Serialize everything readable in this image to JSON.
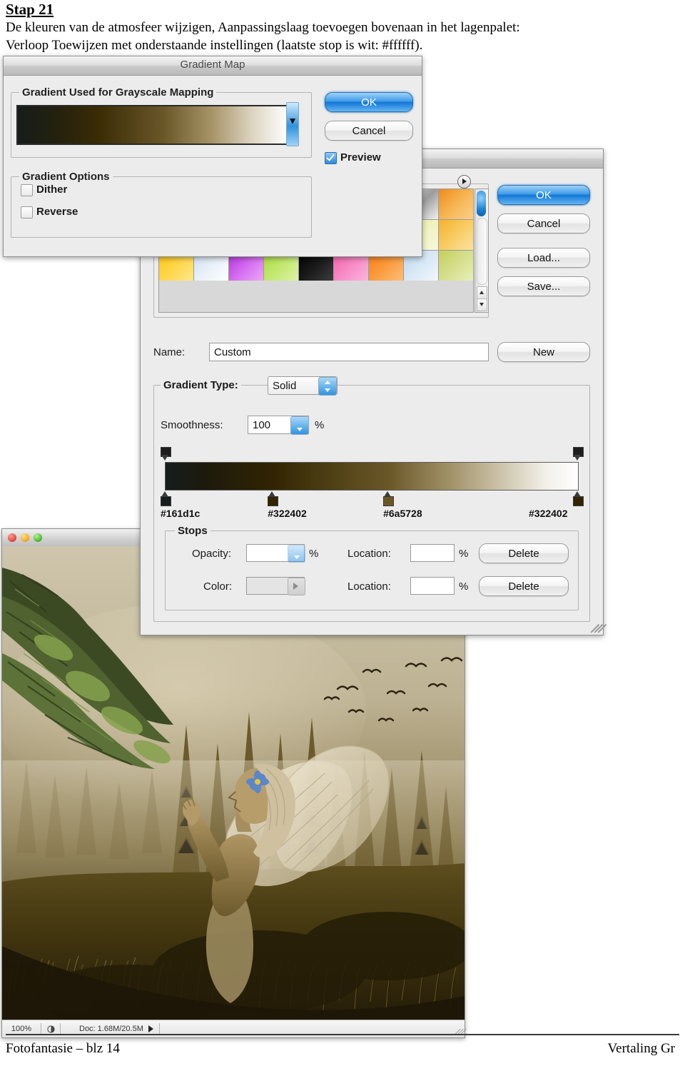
{
  "document": {
    "step_title": "Stap 21",
    "line1": "De kleuren van de atmosfeer wijzigen, Aanpassingslaag toevoegen bovenaan in het lagenpalet:",
    "line2": "Verloop Toewijzen met onderstaande instellingen (laatste stop is wit: #ffffff).",
    "footer_left": "Fotofantasie – blz 14",
    "footer_right": "Vertaling Gr"
  },
  "gradient_map_dialog": {
    "title": "Gradient Map",
    "group_gradient_label": "Gradient Used for Grayscale Mapping",
    "group_options_label": "Gradient Options",
    "dither_label": "Dither",
    "reverse_label": "Reverse",
    "preview_label": "Preview",
    "preview_checked": true,
    "dither_checked": false,
    "reverse_checked": false,
    "ok_label": "OK",
    "cancel_label": "Cancel"
  },
  "gradient_editor_dialog": {
    "ok_label": "OK",
    "cancel_label": "Cancel",
    "load_label": "Load...",
    "save_label": "Save...",
    "new_label": "New",
    "name_label": "Name:",
    "name_value": "Custom",
    "gradient_type_label": "Gradient Type:",
    "gradient_type_value": "Solid",
    "smoothness_label": "Smoothness:",
    "smoothness_value": "100",
    "percent_symbol": "%",
    "stops_group_label": "Stops",
    "opacity_label": "Opacity:",
    "opacity_value": "",
    "color_label": "Color:",
    "location_label": "Location:",
    "opacity_location_value": "",
    "color_location_value": "",
    "delete_label": "Delete",
    "presets": [
      [
        "#3b2e73",
        "#c86a16",
        "#f2a13a",
        "#1a3a74",
        "#0d2a57"
      ],
      [
        "#7a5c3a",
        "#b9a27e",
        "#e3d9c6",
        "#f0ece2"
      ],
      [
        "#efe9d8",
        "#c9a23c",
        "#f3efe4",
        "#ffffff"
      ],
      [
        "#7a2fb0",
        "#2f6fd0",
        "#2fa84f",
        "#d8d021",
        "#cf2222"
      ],
      [
        "#2fa84f",
        "#d8d021",
        "#2f6fd0",
        "#cf2222",
        "#cccccc"
      ],
      [
        "#111111",
        "#ffffff"
      ],
      [
        "#7c1a63",
        "#b4307f",
        "#c94f9c"
      ],
      [
        "#d9d9d9",
        "#9c9c9c",
        "#f2f2f2"
      ],
      [
        "#f08a1c",
        "#f6b552",
        "#fbd08a"
      ],
      [
        "#0f0f0f",
        "#3a3a3a",
        "#8c8c8c"
      ],
      [
        "#63b51e",
        "#9ed856",
        "#c9ef94"
      ],
      [
        "#0b76c4",
        "#2f9ddb",
        "#8fd2f3"
      ],
      [
        "#f07b12",
        "#f9a94a",
        "#fde0ba"
      ],
      [
        "#ffffff",
        "#b9b9b9",
        "#6e6e6e"
      ],
      [
        "#6d8a85",
        "#8fa8a3",
        "#b6c6c2"
      ],
      [
        "#3fc4ef",
        "#8fdff5",
        "#d5f3fb"
      ],
      [
        "#e6e89a",
        "#f0f2c0",
        "#f7f8dd"
      ],
      [
        "#f4b12b",
        "#f8cc63",
        "#fce3a2"
      ],
      [
        "#ffc40d",
        "#ffd64a",
        "#ffe88a"
      ],
      [
        "#cfe0f2",
        "#e8f0f9",
        "#ffffff"
      ],
      [
        "#b02fd8",
        "#d46bf0",
        "#e9a9f7"
      ],
      [
        "#a6d83a",
        "#c2e86f",
        "#dcf3a7"
      ],
      [
        "#000000",
        "#1a1a1a",
        "#3d3d3d"
      ],
      [
        "#f25fae",
        "#f78ac6",
        "#fbb6dc"
      ],
      [
        "#f97c12",
        "#fb9b3d",
        "#fdbd7a"
      ],
      [
        "#bcd7ef",
        "#d8e8f6",
        "#f1f7fc"
      ],
      [
        "#c4cf5a",
        "#d6df8c",
        "#e8eebb"
      ]
    ],
    "gradient_stops": [
      {
        "hex": "#161d1c",
        "location_pct": 0
      },
      {
        "hex": "#322402",
        "location_pct": 26
      },
      {
        "hex": "#6a5728",
        "location_pct": 54
      },
      {
        "hex": "#322402",
        "location_pct": 100
      }
    ],
    "opacity_stops": [
      {
        "location_pct": 0
      },
      {
        "location_pct": 100
      }
    ]
  },
  "document_window": {
    "zoom_level": "100%",
    "doc_info": "Doc: 1.68M/20.5M"
  },
  "colors": {
    "accent_blue": "#1377d6",
    "panel_gray": "#ececec",
    "gradient_dark": "#161d1c",
    "gradient_brown": "#322402",
    "gradient_tan": "#6a5728",
    "gradient_white": "#ffffff"
  }
}
